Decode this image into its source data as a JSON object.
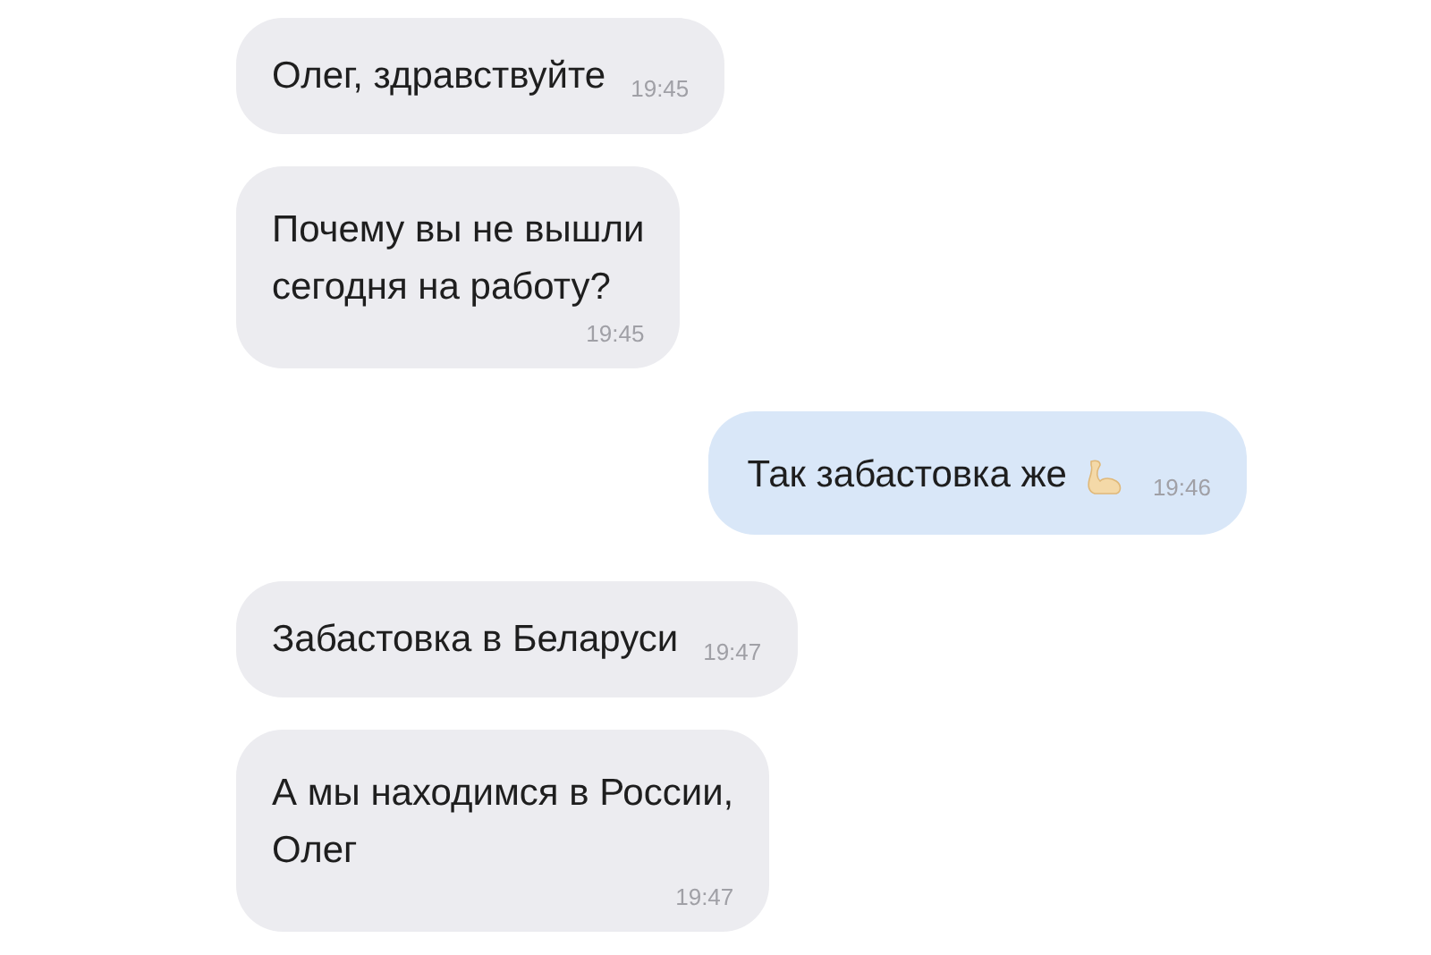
{
  "messages": [
    {
      "kind": "incoming",
      "text": "Олег, здравствуйте",
      "time": "19:45"
    },
    {
      "kind": "incoming",
      "text": "Почему вы не вышли\nсегодня на работу?",
      "time": "19:45"
    },
    {
      "kind": "outgoing",
      "text": "Так забастовка же",
      "time": "19:46"
    },
    {
      "kind": "incoming",
      "text": "Забастовка в Беларуси",
      "time": "19:47"
    },
    {
      "kind": "incoming",
      "text": "А мы находимся в России,\nОлег",
      "time": "19:47"
    }
  ]
}
